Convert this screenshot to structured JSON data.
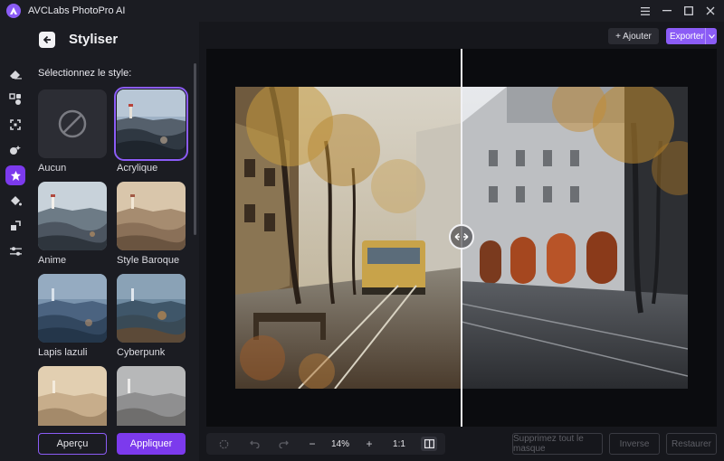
{
  "app": {
    "title": "AVCLabs PhotoPro AI"
  },
  "panel": {
    "title": "Styliser",
    "section_label": "Sélectionnez le style:",
    "styles": [
      {
        "label": "Aucun",
        "selected": false
      },
      {
        "label": "Acrylique",
        "selected": true
      },
      {
        "label": "Anime",
        "selected": false
      },
      {
        "label": "Style Baroque",
        "selected": false
      },
      {
        "label": "Lapis lazuli",
        "selected": false
      },
      {
        "label": "Cyberpunk",
        "selected": false
      },
      {
        "label": "",
        "selected": false
      },
      {
        "label": "",
        "selected": false
      }
    ],
    "preview_label": "Aperçu",
    "apply_label": "Appliquer"
  },
  "header": {
    "add_label": "+ Ajouter",
    "export_label": "Exporter"
  },
  "toolbar": {
    "zoom_minus": "−",
    "zoom_value": "14%",
    "zoom_plus": "+",
    "ratio_label": "1:1",
    "remove_mask_label": "Supprimez tout le masque",
    "invert_label": "Inverse",
    "restore_label": "Restaurer"
  },
  "colors": {
    "accent": "#8b5cf6",
    "accent_dark": "#7c3aed",
    "bg": "#16171c",
    "panel": "#1b1c22"
  }
}
